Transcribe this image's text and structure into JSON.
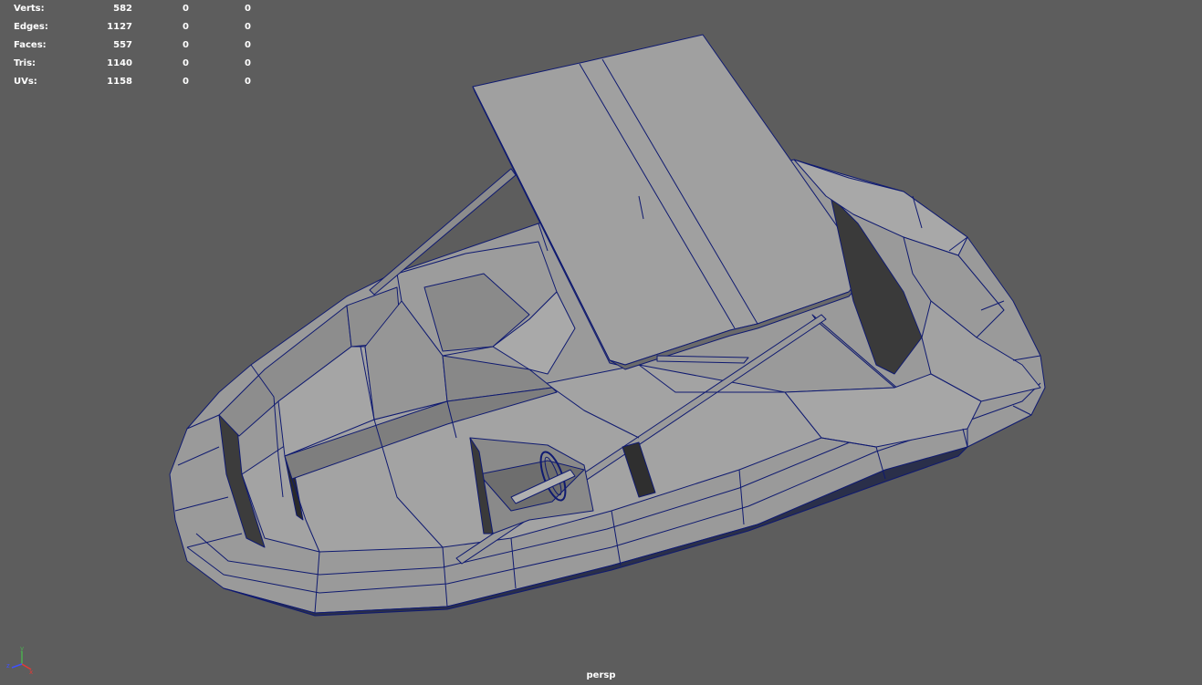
{
  "viewport": {
    "camera": "persp",
    "background_color": "#5d5d5d",
    "wire_color": "#0f1a70",
    "shade_color": "#a0a0a0"
  },
  "hud": {
    "rows": [
      {
        "label": "Verts:",
        "v1": "582",
        "v2": "0",
        "v3": "0"
      },
      {
        "label": "Edges:",
        "v1": "1127",
        "v2": "0",
        "v3": "0"
      },
      {
        "label": "Faces:",
        "v1": "557",
        "v2": "0",
        "v3": "0"
      },
      {
        "label": "Tris:",
        "v1": "1140",
        "v2": "0",
        "v3": "0"
      },
      {
        "label": "UVs:",
        "v1": "1158",
        "v2": "0",
        "v3": "0"
      }
    ]
  },
  "axis": {
    "x": "x",
    "y": "y",
    "z": "z"
  }
}
